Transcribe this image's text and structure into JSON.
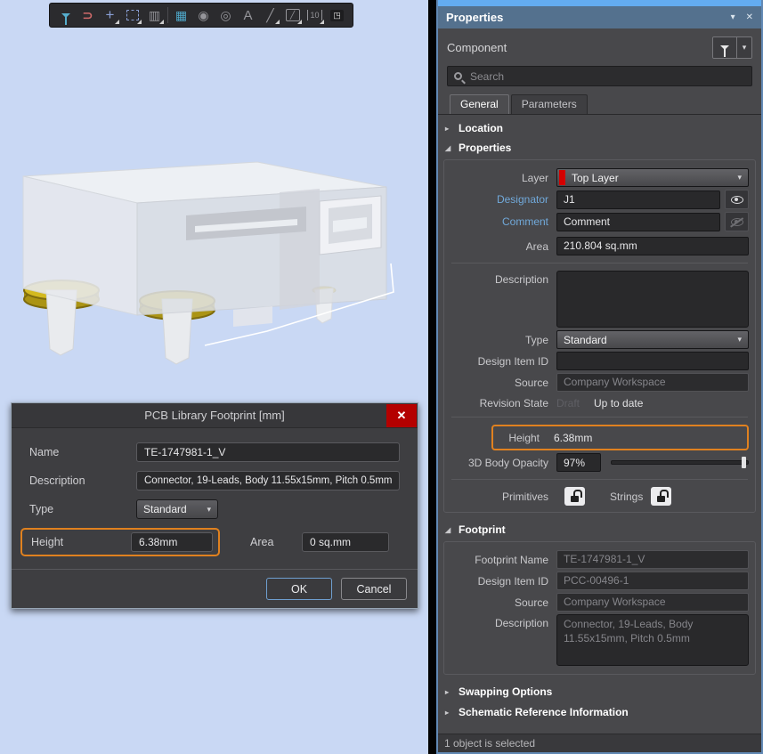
{
  "ui": {
    "collapsed_marker": "▸",
    "expanded_marker": "◢",
    "dropdown_arrow": "▾",
    "close_glyph": "✕"
  },
  "colors": {
    "accent_orange": "#e0811f",
    "layer_red": "#d40000",
    "top_strip_blue": "#63acf1",
    "titlebar_blue": "#54718e"
  },
  "toolbar": {
    "icons": [
      {
        "name": "filter-icon",
        "glyph": ""
      },
      {
        "name": "magnet-icon",
        "glyph": "⊃"
      },
      {
        "name": "crosshair-icon",
        "glyph": "+"
      },
      {
        "name": "selection-rect-icon",
        "glyph": ""
      },
      {
        "name": "placement-grid-icon",
        "glyph": "▥"
      },
      {
        "name": "component-chip-icon",
        "glyph": "▦"
      },
      {
        "name": "pad-icon",
        "glyph": "◉"
      },
      {
        "name": "via-icon",
        "glyph": "◎"
      },
      {
        "name": "text-icon",
        "glyph": "A"
      },
      {
        "name": "line-icon",
        "glyph": "╱"
      },
      {
        "name": "trace-icon",
        "glyph": "╱"
      },
      {
        "name": "dimension-icon",
        "glyph": "10"
      },
      {
        "name": "room-icon",
        "glyph": "◳"
      }
    ]
  },
  "dialog": {
    "title": "PCB Library Footprint [mm]",
    "name": {
      "label": "Name",
      "value": "TE-1747981-1_V"
    },
    "description": {
      "label": "Description",
      "value": "Connector, 19-Leads, Body 11.55x15mm, Pitch 0.5mm"
    },
    "type": {
      "label": "Type",
      "value": "Standard"
    },
    "height": {
      "label": "Height",
      "value": "6.38mm"
    },
    "area": {
      "label": "Area",
      "value": "0 sq.mm"
    },
    "ok_label": "OK",
    "cancel_label": "Cancel"
  },
  "panel": {
    "title": "Properties",
    "component_label": "Component",
    "search_placeholder": "Search",
    "tabs": [
      {
        "label": "General"
      },
      {
        "label": "Parameters"
      }
    ],
    "location": {
      "label": "Location"
    },
    "properties": {
      "label": "Properties",
      "layer": {
        "label": "Layer",
        "value": "Top Layer"
      },
      "designator": {
        "label": "Designator",
        "value": "J1"
      },
      "comment": {
        "label": "Comment",
        "value": "Comment"
      },
      "area": {
        "label": "Area",
        "value": "210.804 sq.mm"
      },
      "description": {
        "label": "Description",
        "value": ""
      },
      "type": {
        "label": "Type",
        "value": "Standard"
      },
      "design_item_id": {
        "label": "Design Item ID",
        "value": ""
      },
      "source": {
        "label": "Source",
        "value": "Company Workspace"
      },
      "revision_state": {
        "label": "Revision State",
        "draft": "Draft",
        "state": "Up to date"
      },
      "height": {
        "label": "Height",
        "value": "6.38mm"
      },
      "opacity": {
        "label": "3D Body Opacity",
        "value": "97%"
      },
      "primitives_label": "Primitives",
      "strings_label": "Strings"
    },
    "footprint": {
      "label": "Footprint",
      "footprint_name": {
        "label": "Footprint Name",
        "value": "TE-1747981-1_V"
      },
      "design_item_id": {
        "label": "Design Item ID",
        "value": "PCC-00496-1"
      },
      "source": {
        "label": "Source",
        "value": "Company Workspace"
      },
      "description": {
        "label": "Description",
        "value": "Connector, 19-Leads, Body 11.55x15mm, Pitch 0.5mm"
      }
    },
    "swapping": {
      "label": "Swapping Options"
    },
    "schematic_ref": {
      "label": "Schematic Reference Information"
    },
    "status": "1 object is selected"
  }
}
